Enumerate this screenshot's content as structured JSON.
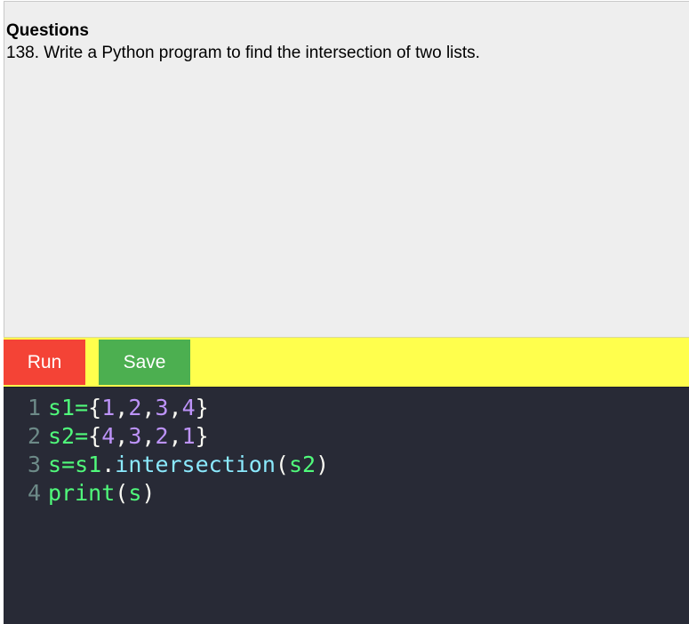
{
  "question": {
    "heading": "Questions",
    "text": "138. Write a Python program to find the intersection of two lists."
  },
  "toolbar": {
    "run_label": "Run",
    "save_label": "Save"
  },
  "editor": {
    "lines": [
      {
        "number": "1",
        "tokens": [
          {
            "t": "s1",
            "c": "var"
          },
          {
            "t": "=",
            "c": "var"
          },
          {
            "t": "{",
            "c": "pun"
          },
          {
            "t": "1",
            "c": "num"
          },
          {
            "t": ",",
            "c": "pun"
          },
          {
            "t": "2",
            "c": "num"
          },
          {
            "t": ",",
            "c": "pun"
          },
          {
            "t": "3",
            "c": "num"
          },
          {
            "t": ",",
            "c": "pun"
          },
          {
            "t": "4",
            "c": "num"
          },
          {
            "t": "}",
            "c": "pun"
          }
        ]
      },
      {
        "number": "2",
        "tokens": [
          {
            "t": "s2",
            "c": "var"
          },
          {
            "t": "=",
            "c": "var"
          },
          {
            "t": "{",
            "c": "pun"
          },
          {
            "t": "4",
            "c": "num"
          },
          {
            "t": ",",
            "c": "pun"
          },
          {
            "t": "3",
            "c": "num"
          },
          {
            "t": ",",
            "c": "pun"
          },
          {
            "t": "2",
            "c": "num"
          },
          {
            "t": ",",
            "c": "pun"
          },
          {
            "t": "1",
            "c": "num"
          },
          {
            "t": "}",
            "c": "pun"
          }
        ]
      },
      {
        "number": "3",
        "tokens": [
          {
            "t": "s",
            "c": "var"
          },
          {
            "t": "=",
            "c": "var"
          },
          {
            "t": "s1",
            "c": "var"
          },
          {
            "t": ".",
            "c": "pun"
          },
          {
            "t": "intersection",
            "c": "fn"
          },
          {
            "t": "(",
            "c": "pun"
          },
          {
            "t": "s2",
            "c": "var"
          },
          {
            "t": ")",
            "c": "pun"
          }
        ]
      },
      {
        "number": "4",
        "tokens": [
          {
            "t": "print",
            "c": "kw"
          },
          {
            "t": "(",
            "c": "pun"
          },
          {
            "t": "s",
            "c": "var"
          },
          {
            "t": ")",
            "c": "pun"
          }
        ]
      }
    ]
  },
  "colors": {
    "run_button": "#f44336",
    "save_button": "#4caf50",
    "toolbar_bg": "#ffff4d",
    "editor_bg": "#282a36"
  }
}
